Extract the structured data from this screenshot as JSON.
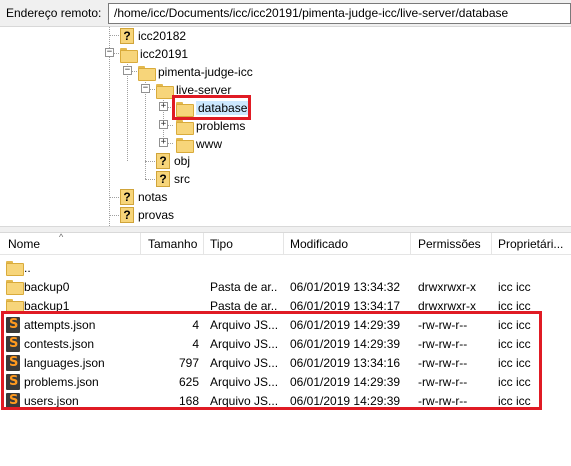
{
  "remote": {
    "label": "Endereço remoto:",
    "path": "/home/icc/Documents/icc/icc20191/pimenta-judge-icc/live-server/database"
  },
  "tree": {
    "items": [
      {
        "label": "icc20182",
        "icon": "unknown-folder-icon"
      },
      {
        "label": "icc20191",
        "icon": "folder-icon"
      },
      {
        "label": "pimenta-judge-icc",
        "icon": "folder-icon"
      },
      {
        "label": "live-server",
        "icon": "folder-icon"
      },
      {
        "label": "database",
        "icon": "folder-icon",
        "selected": true
      },
      {
        "label": "problems",
        "icon": "folder-icon"
      },
      {
        "label": "www",
        "icon": "folder-icon"
      },
      {
        "label": "obj",
        "icon": "unknown-folder-icon"
      },
      {
        "label": "src",
        "icon": "unknown-folder-icon"
      },
      {
        "label": "notas",
        "icon": "unknown-folder-icon"
      },
      {
        "label": "provas",
        "icon": "unknown-folder-icon"
      }
    ],
    "expander_minus": "−",
    "expander_plus": "+"
  },
  "columns": {
    "name": "Nome",
    "size": "Tamanho",
    "type": "Tipo",
    "modified": "Modificado",
    "permissions": "Permissões",
    "owner": "Proprietári..."
  },
  "files": [
    {
      "name": "..",
      "size": "",
      "type": "",
      "modified": "",
      "permissions": "",
      "owner": "",
      "icon": "folder-icon"
    },
    {
      "name": "backup0",
      "size": "",
      "type": "Pasta de ar...",
      "modified": "06/01/2019 13:34:32",
      "permissions": "drwxrwxr-x",
      "owner": "icc icc",
      "icon": "folder-icon"
    },
    {
      "name": "backup1",
      "size": "",
      "type": "Pasta de ar...",
      "modified": "06/01/2019 13:34:17",
      "permissions": "drwxrwxr-x",
      "owner": "icc icc",
      "icon": "folder-icon"
    },
    {
      "name": "attempts.json",
      "size": "4",
      "type": "Arquivo JS...",
      "modified": "06/01/2019 14:29:39",
      "permissions": "-rw-rw-r--",
      "owner": "icc icc",
      "icon": "json-file-icon"
    },
    {
      "name": "contests.json",
      "size": "4",
      "type": "Arquivo JS...",
      "modified": "06/01/2019 14:29:39",
      "permissions": "-rw-rw-r--",
      "owner": "icc icc",
      "icon": "json-file-icon"
    },
    {
      "name": "languages.json",
      "size": "797",
      "type": "Arquivo JS...",
      "modified": "06/01/2019 13:34:16",
      "permissions": "-rw-rw-r--",
      "owner": "icc icc",
      "icon": "json-file-icon"
    },
    {
      "name": "problems.json",
      "size": "625",
      "type": "Arquivo JS...",
      "modified": "06/01/2019 14:29:39",
      "permissions": "-rw-rw-r--",
      "owner": "icc icc",
      "icon": "json-file-icon"
    },
    {
      "name": "users.json",
      "size": "168",
      "type": "Arquivo JS...",
      "modified": "06/01/2019 14:29:39",
      "permissions": "-rw-rw-r--",
      "owner": "icc icc",
      "icon": "json-file-icon"
    }
  ],
  "glyphs": {
    "unknown": "?",
    "json": "S",
    "sort": "^"
  },
  "colors": {
    "highlight": "#e01b24",
    "folder": "#f7d57a",
    "json_icon_bg": "#3a3a3a",
    "json_icon_fg": "#ff9a1f"
  }
}
